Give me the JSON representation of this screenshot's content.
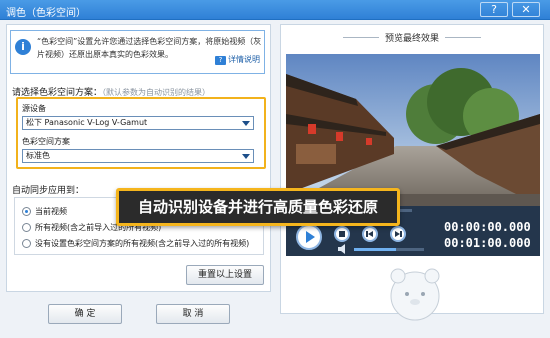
{
  "window": {
    "title": "调色（色彩空间）"
  },
  "info": {
    "text": "“色彩空间”设置允许您通过选择色彩空间方案，将原始视频（灰片视频）还原出原本真实的色彩效果。",
    "help_label": "详情说明"
  },
  "section": {
    "title": "请选择色彩空间方案：",
    "hint": "（默认参数为自动识别的结果）"
  },
  "source": {
    "label": "源设备",
    "value": "松下 Panasonic V-Log V-Gamut"
  },
  "colorspace": {
    "label": "色彩空间方案",
    "value": "标准色"
  },
  "sync": {
    "title": "自动同步应用到：",
    "options": [
      "当前视频",
      "所有视频(含之前导入过的所有视频)",
      "没有设置色彩空间方案的所有视频(含之前导入过的所有视频)"
    ]
  },
  "buttons": {
    "reset": "重置以上设置",
    "ok": "确 定",
    "cancel": "取 消"
  },
  "preview": {
    "title": "预览最终效果",
    "time_current": "00:00:00.000",
    "time_total": "00:01:00.000"
  },
  "playback": {
    "volume": 0.6
  },
  "banner": {
    "text": "自动识别设备并进行高质量色彩还原"
  },
  "colors": {
    "accent": "#2f80d6",
    "highlight": "#f2b21c",
    "control_bar": "#24364c"
  }
}
